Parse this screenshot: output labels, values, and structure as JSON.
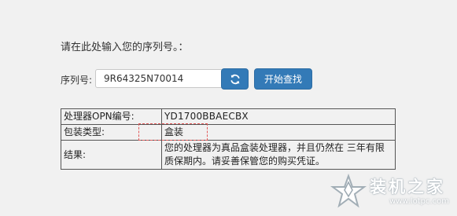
{
  "prompt": "请在此处输入您的序列号。：",
  "serial": {
    "label": "序列号:",
    "value": "9R64325N70014"
  },
  "buttons": {
    "refresh_icon": "refresh-icon",
    "search_label": "开始查找"
  },
  "results": {
    "rows": [
      {
        "key": "处理器OPN编号:",
        "value": "YD1700BBAECBX"
      },
      {
        "key": "包装类型:",
        "value": "盒装"
      },
      {
        "key": "结果:",
        "value": "您的处理器为真品盒装处理器，并且仍然在 三年有限质保期内。请妥善保管您的购买凭证。"
      }
    ]
  },
  "watermark": {
    "title": "装机之家",
    "url": "www.lotpc.com"
  },
  "colors": {
    "background": "#f1f1f1",
    "button": "#337ab7",
    "highlight": "#e25a5a"
  }
}
